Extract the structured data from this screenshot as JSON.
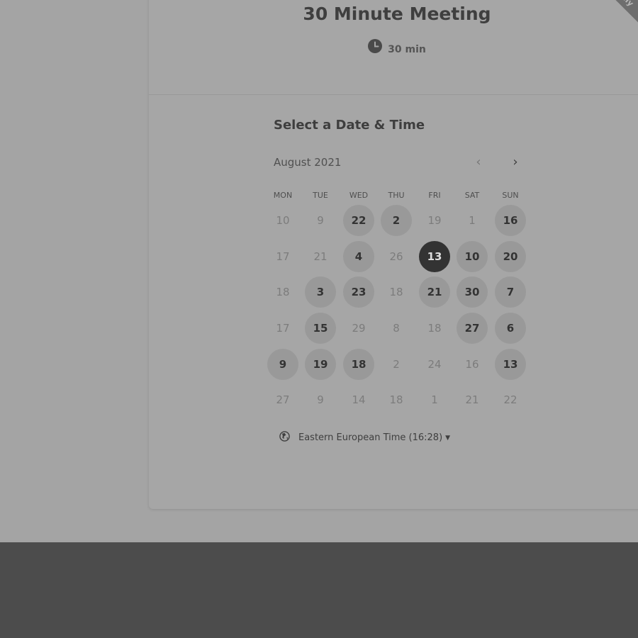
{
  "event": {
    "title": "30 Minute Meeting",
    "duration": "30 min",
    "ribbon_text": "...ly"
  },
  "calendar": {
    "heading": "Select a Date & Time",
    "month_label": "August 2021",
    "prev_icon": "chevron-left-icon",
    "next_icon": "chevron-right-icon",
    "weekdays": [
      "MON",
      "TUE",
      "WED",
      "THU",
      "FRI",
      "SAT",
      "SUN"
    ],
    "weeks": [
      [
        {
          "label": "10",
          "state": "disabled"
        },
        {
          "label": "9",
          "state": "disabled"
        },
        {
          "label": "22",
          "state": "available"
        },
        {
          "label": "2",
          "state": "available"
        },
        {
          "label": "19",
          "state": "disabled"
        },
        {
          "label": "1",
          "state": "disabled"
        },
        {
          "label": "16",
          "state": "available"
        }
      ],
      [
        {
          "label": "17",
          "state": "disabled"
        },
        {
          "label": "21",
          "state": "disabled"
        },
        {
          "label": "4",
          "state": "available"
        },
        {
          "label": "26",
          "state": "disabled"
        },
        {
          "label": "13",
          "state": "selected"
        },
        {
          "label": "10",
          "state": "available"
        },
        {
          "label": "20",
          "state": "available"
        }
      ],
      [
        {
          "label": "18",
          "state": "disabled"
        },
        {
          "label": "3",
          "state": "available"
        },
        {
          "label": "23",
          "state": "available"
        },
        {
          "label": "18",
          "state": "disabled"
        },
        {
          "label": "21",
          "state": "available"
        },
        {
          "label": "30",
          "state": "available"
        },
        {
          "label": "7",
          "state": "available"
        }
      ],
      [
        {
          "label": "17",
          "state": "disabled"
        },
        {
          "label": "15",
          "state": "available"
        },
        {
          "label": "29",
          "state": "disabled"
        },
        {
          "label": "8",
          "state": "disabled"
        },
        {
          "label": "18",
          "state": "disabled"
        },
        {
          "label": "27",
          "state": "available"
        },
        {
          "label": "6",
          "state": "available"
        }
      ],
      [
        {
          "label": "9",
          "state": "available"
        },
        {
          "label": "19",
          "state": "available"
        },
        {
          "label": "18",
          "state": "available"
        },
        {
          "label": "2",
          "state": "disabled"
        },
        {
          "label": "24",
          "state": "disabled"
        },
        {
          "label": "16",
          "state": "disabled"
        },
        {
          "label": "13",
          "state": "available"
        }
      ],
      [
        {
          "label": "27",
          "state": "disabled"
        },
        {
          "label": "9",
          "state": "disabled"
        },
        {
          "label": "14",
          "state": "disabled"
        },
        {
          "label": "18",
          "state": "disabled"
        },
        {
          "label": "1",
          "state": "disabled"
        },
        {
          "label": "21",
          "state": "disabled"
        },
        {
          "label": "22",
          "state": "disabled"
        }
      ]
    ]
  },
  "timezone": {
    "label": "Eastern European Time (16:28)",
    "icon": "globe-icon"
  },
  "colors": {
    "page_background": "#a4a4a4",
    "footer_band": "#4c4c4c",
    "available_day": "#999999",
    "selected_day": "#333333"
  }
}
